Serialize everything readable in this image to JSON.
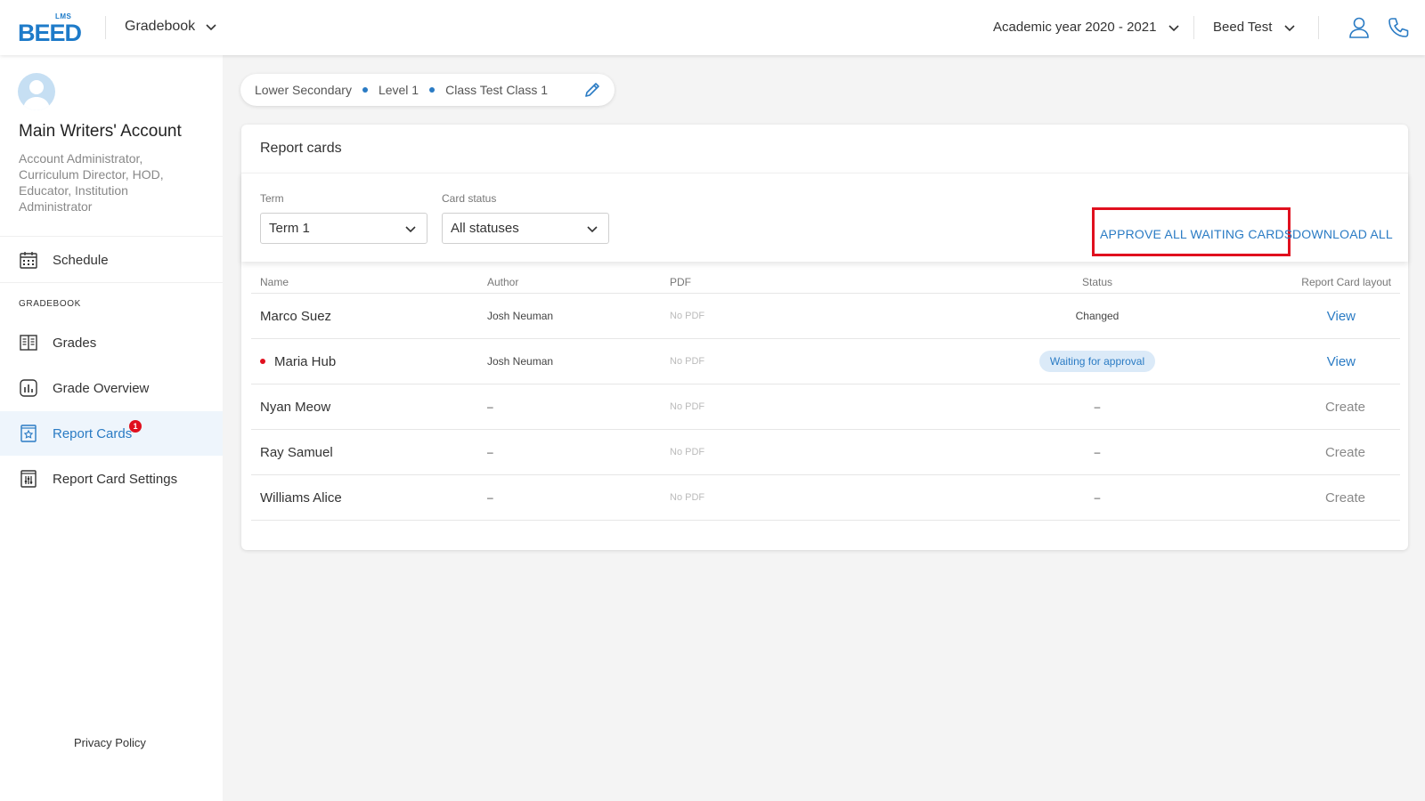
{
  "brand": {
    "logo_text": "BEED",
    "logo_sub": "LMS"
  },
  "header": {
    "app_select": "Gradebook",
    "academic_year": "Academic year 2020 - 2021",
    "institution": "Beed Test",
    "icons": [
      "user-icon",
      "phone-icon"
    ]
  },
  "sidebar": {
    "user_name": "Main Writers' Account",
    "user_roles": "Account Administrator, Curriculum Director, HOD, Educator, Institution Administrator",
    "schedule_label": "Schedule",
    "section_label": "GRADEBOOK",
    "items": [
      {
        "label": "Grades",
        "icon": "book-icon"
      },
      {
        "label": "Grade Overview",
        "icon": "chart-icon"
      },
      {
        "label": "Report Cards",
        "icon": "report-card-icon",
        "badge": "1",
        "active": true
      },
      {
        "label": "Report Card Settings",
        "icon": "settings-card-icon"
      }
    ],
    "privacy": "Privacy Policy"
  },
  "breadcrumb": [
    "Lower Secondary",
    "Level 1",
    "Class Test Class 1"
  ],
  "panel": {
    "title": "Report cards",
    "term_label": "Term",
    "term_value": "Term 1",
    "status_label": "Card status",
    "status_value": "All statuses",
    "approve_all": "APPROVE ALL WAITING CARDS",
    "download_all": "DOWNLOAD ALL"
  },
  "table": {
    "headers": {
      "name": "Name",
      "author": "Author",
      "pdf": "PDF",
      "status": "Status",
      "layout": "Report Card layout"
    },
    "rows": [
      {
        "name": "Marco Suez",
        "author": "Josh Neuman",
        "pdf": "No PDF",
        "status": "Changed",
        "action": "View",
        "flag": false
      },
      {
        "name": "Maria Hub",
        "author": "Josh Neuman",
        "pdf": "No PDF",
        "status": "Waiting for approval",
        "action": "View",
        "flag": true
      },
      {
        "name": "Nyan Meow",
        "author": "–",
        "pdf": "No PDF",
        "status": "–",
        "action": "Create",
        "flag": false
      },
      {
        "name": "Ray Samuel",
        "author": "–",
        "pdf": "No PDF",
        "status": "–",
        "action": "Create",
        "flag": false
      },
      {
        "name": "Williams Alice",
        "author": "–",
        "pdf": "No PDF",
        "status": "–",
        "action": "Create",
        "flag": false
      }
    ]
  },
  "colors": {
    "accent": "#2a7bc4",
    "highlight": "#e0101e",
    "pill_bg": "#dbeaf8"
  }
}
